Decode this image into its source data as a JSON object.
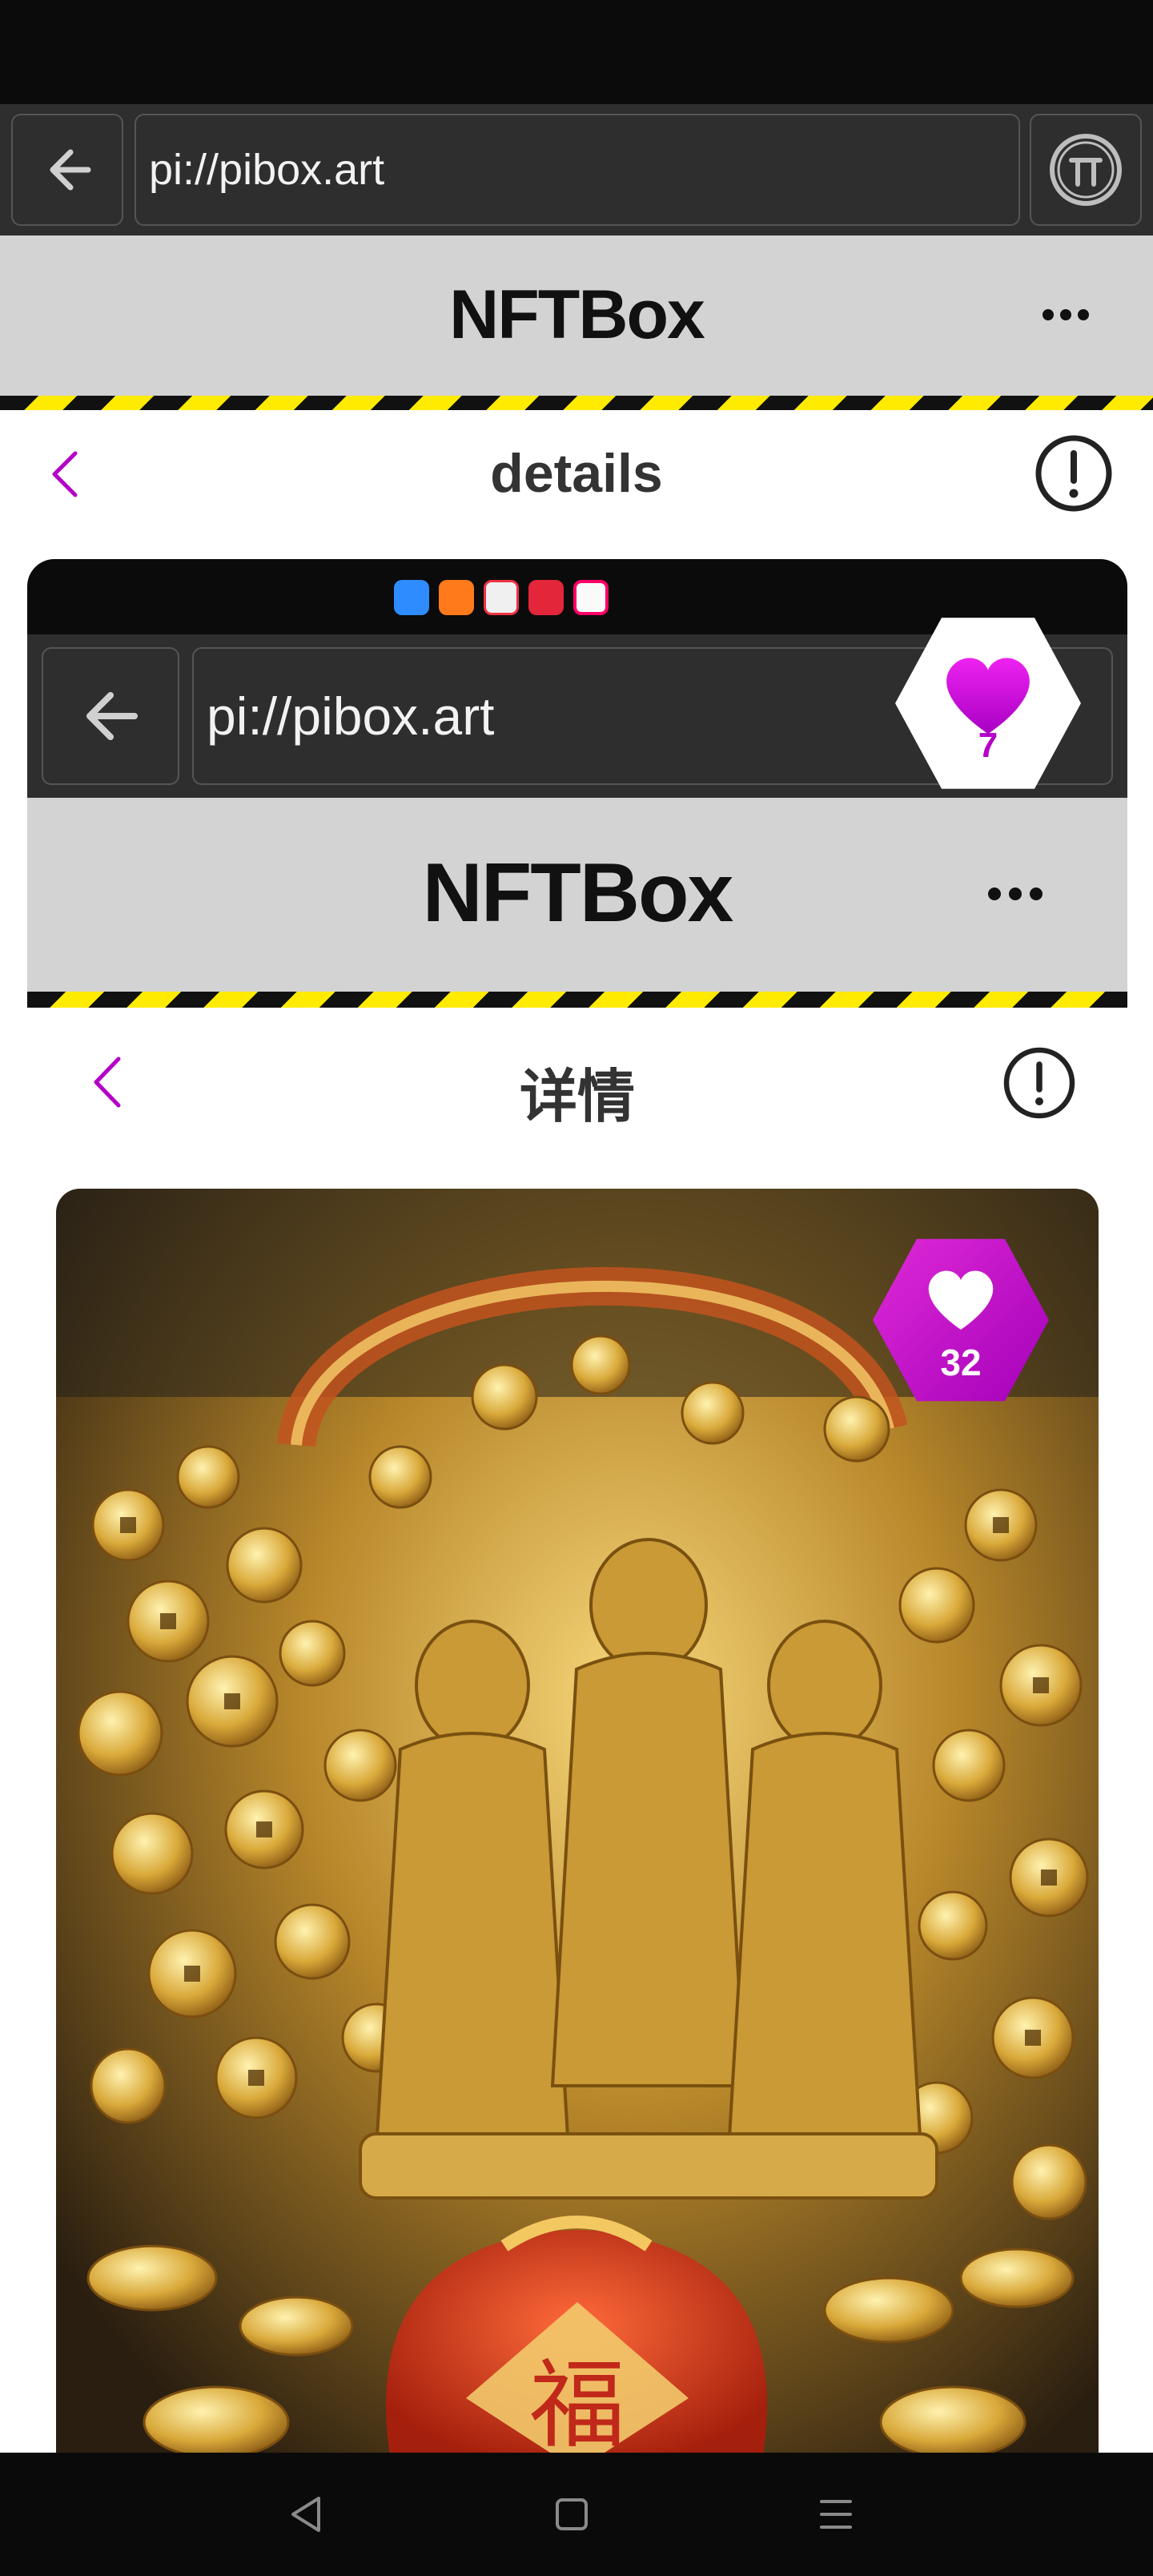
{
  "browser": {
    "url": "pi://pibox.art",
    "back_icon": "arrow-left-icon",
    "pi_icon": "pi-coin-icon"
  },
  "header": {
    "title": "NFTBox",
    "menu_icon": "more-horizontal-icon"
  },
  "page": {
    "title": "details",
    "back_icon": "chevron-left-icon",
    "info_icon": "exclamation-circle-icon"
  },
  "embedded": {
    "url": "pi://pibox.art",
    "app_title": "NFTBox",
    "page_title": "详情",
    "app_icons": [
      "cloud-app-icon",
      "video-app-icon",
      "books-app-icon",
      "huawei-app-icon",
      "browser-app-icon"
    ],
    "like_count": "32"
  },
  "overlay_like": {
    "count": "7"
  },
  "nav": {
    "back_icon": "triangle-back-icon",
    "home_icon": "square-home-icon",
    "menu_icon": "menu-lines-icon"
  },
  "colors": {
    "accent": "#b400c8",
    "hazard_yellow": "#ffeb00",
    "header_gray": "#d3d3d3"
  }
}
